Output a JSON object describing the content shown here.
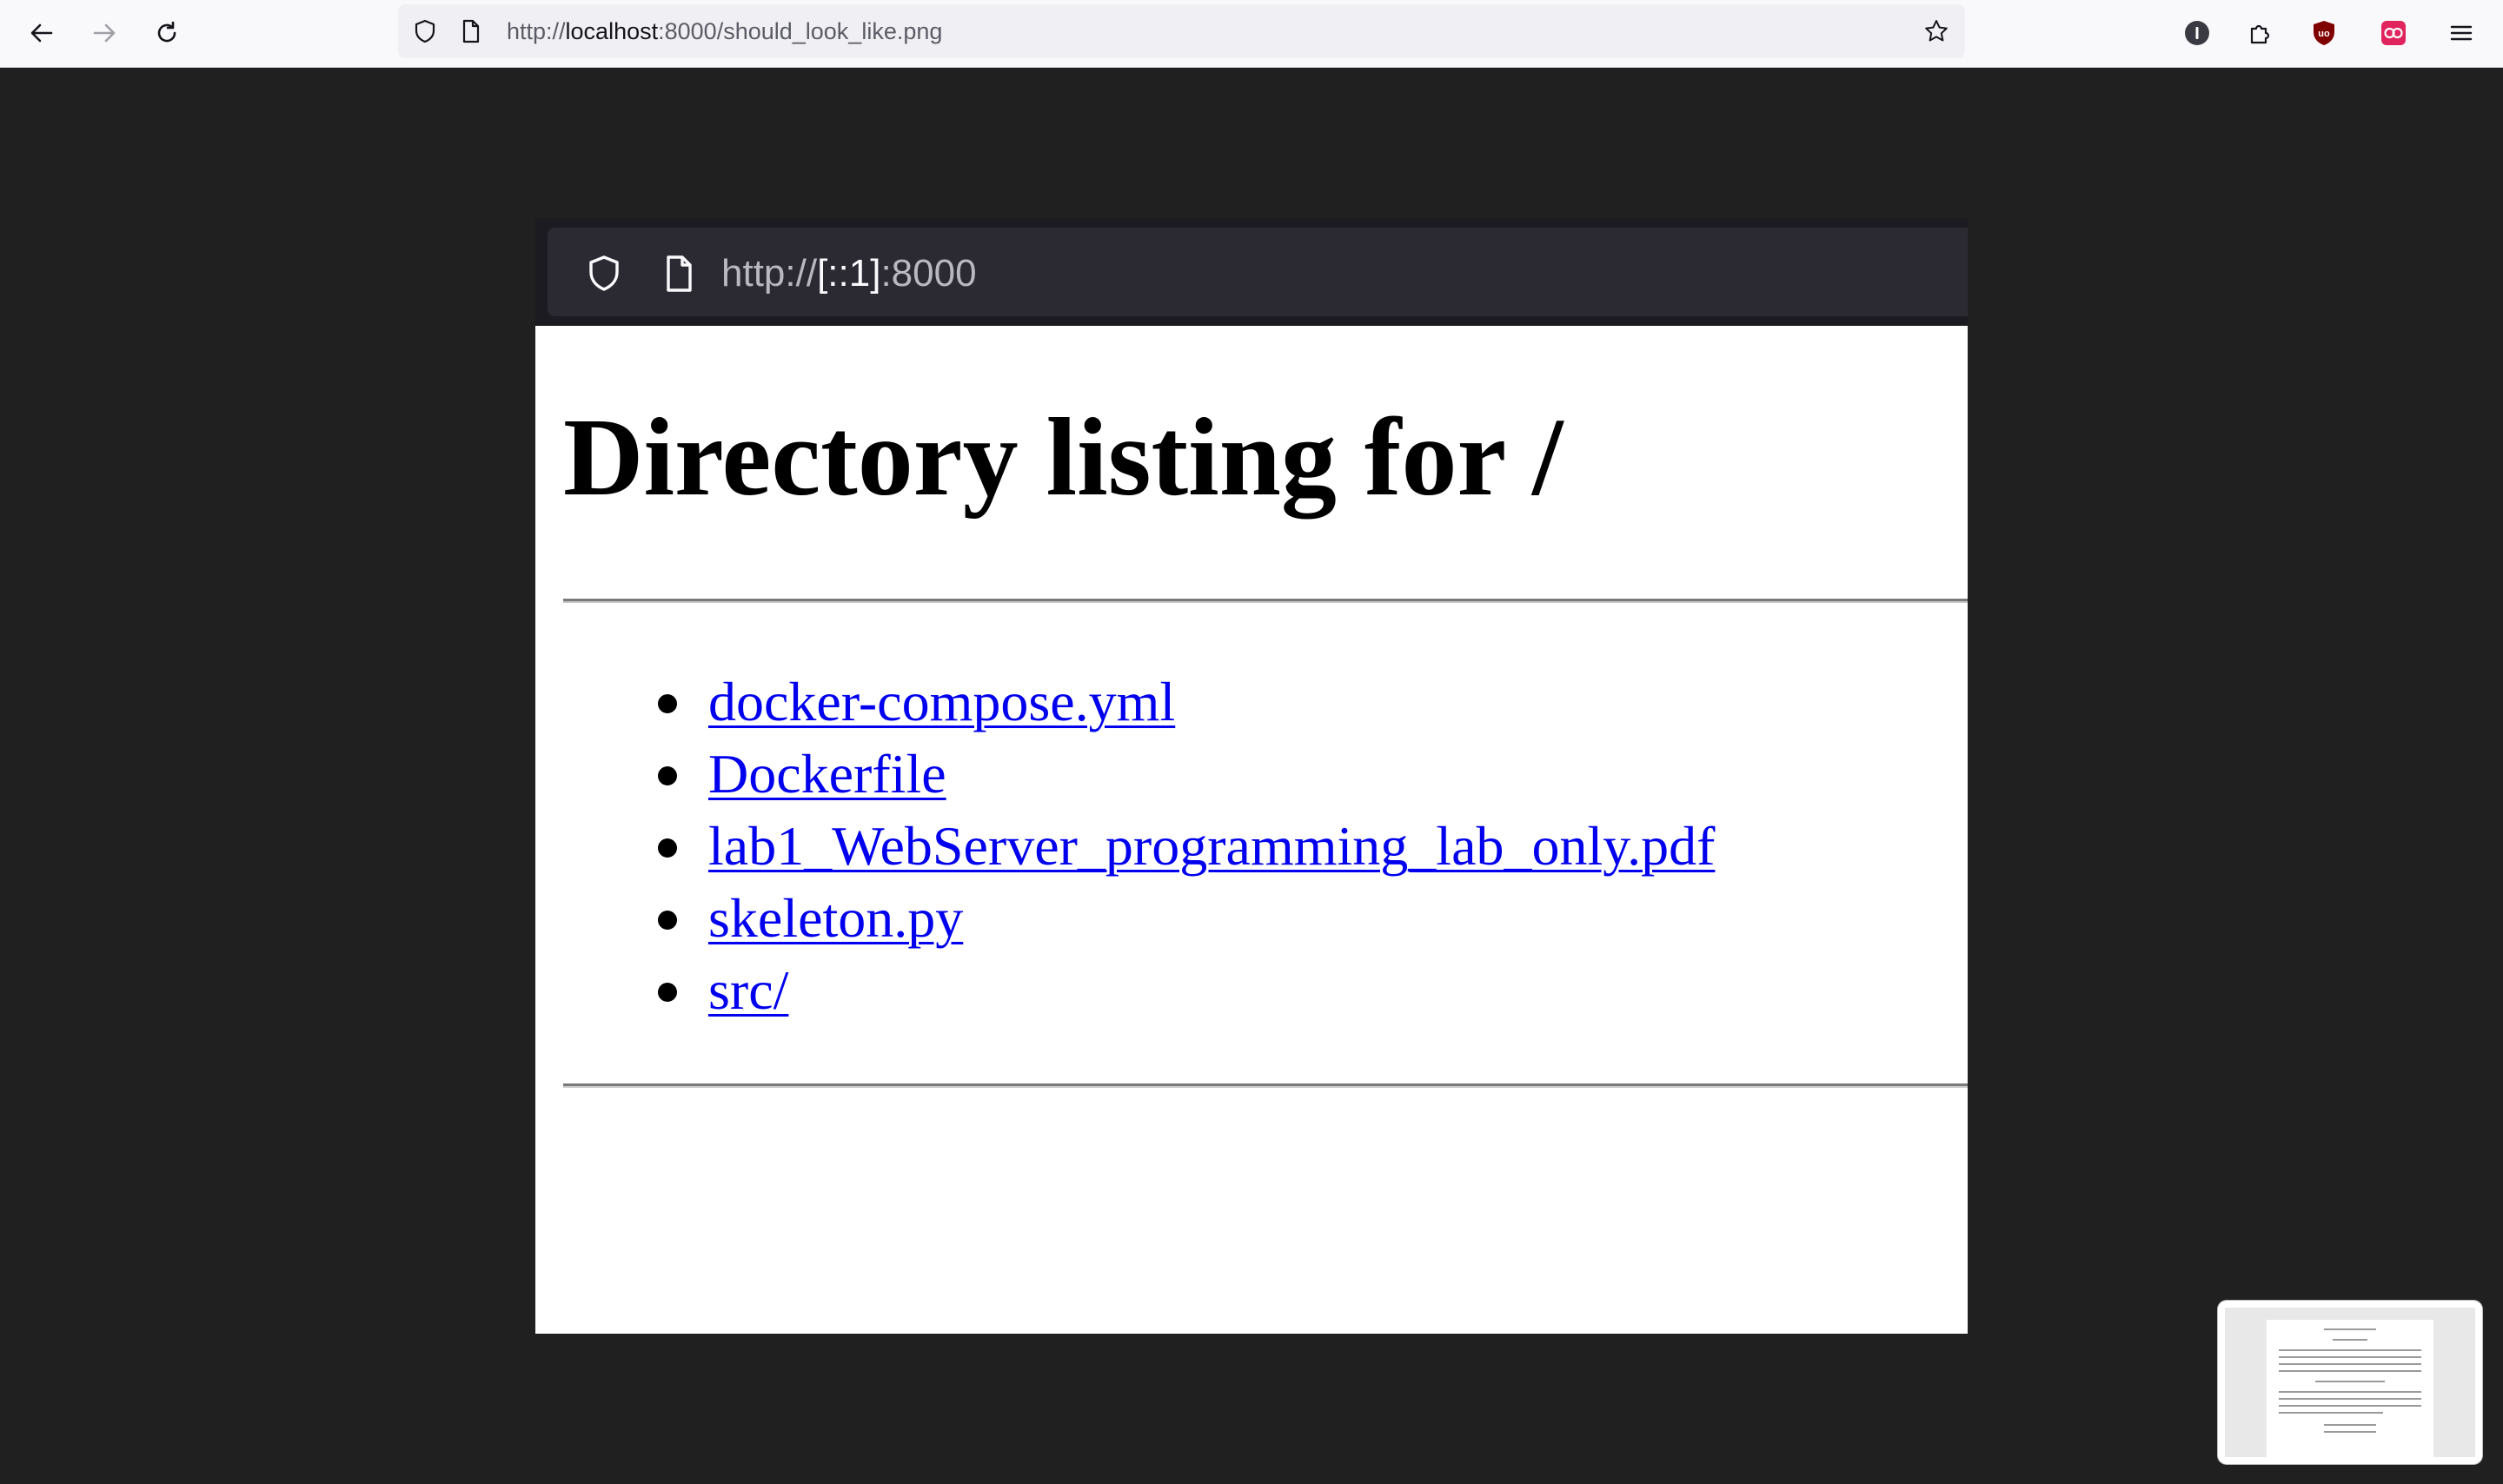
{
  "browser": {
    "url_prefix": "http://",
    "url_host": "localhost",
    "url_rest": ":8000/should_look_like.png"
  },
  "screenshot": {
    "url_prefix": "http://",
    "url_host": "[::1]",
    "url_rest": ":8000",
    "heading": "Directory listing for /",
    "files": [
      "docker-compose.yml",
      "Dockerfile",
      "lab1_WebServer_programming_lab_only.pdf",
      "skeleton.py",
      "src/"
    ]
  },
  "colors": {
    "link": "#0000ee",
    "page_bg": "#202020",
    "toolbar_bg": "#f9f9fb"
  }
}
